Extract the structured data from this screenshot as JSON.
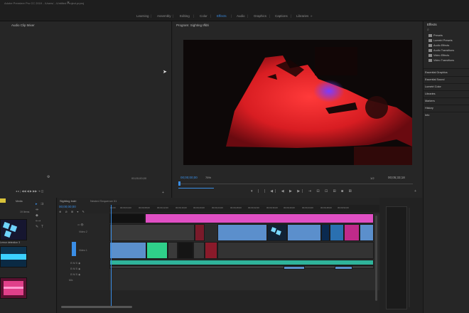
{
  "app": {
    "window_title": "Adobe Premiere Pro CC 2019 - /Users/.../Untitled Project.prproj"
  },
  "workspaces": [
    {
      "label": "Learning",
      "active": false
    },
    {
      "label": "Assembly",
      "active": false
    },
    {
      "label": "Editing",
      "active": false
    },
    {
      "label": "Color",
      "active": false
    },
    {
      "label": "Effects",
      "active": true
    },
    {
      "label": "Audio",
      "active": false
    },
    {
      "label": "Graphics",
      "active": false
    },
    {
      "label": "Captions",
      "active": false
    },
    {
      "label": "Libraries",
      "active": false
    }
  ],
  "source_panel": {
    "tab": "Audio Clip Mixer",
    "timecode": "00;00;00;00"
  },
  "program_panel": {
    "tab": "Program: Sighting Indri",
    "timecode": "00;00;00;00",
    "zoom": "75%",
    "resolution": "1/2",
    "duration": "00;05;33;18"
  },
  "effects_panel": {
    "title": "Effects",
    "search_icon": "search-icon",
    "folders": [
      "Presets",
      "Lumetri Presets",
      "Audio Effects",
      "Audio Transitions",
      "Video Effects",
      "Video Transitions"
    ],
    "sections": [
      "Essential Graphics",
      "Essential Sound",
      "Lumetri Color",
      "Libraries",
      "Markers",
      "History",
      "Info"
    ]
  },
  "project_panel": {
    "tabs": [
      "Media"
    ],
    "count_label": "19 Items",
    "items": [
      {
        "label": "",
        "color": "#3a3a5a"
      },
      {
        "label": "Lemur detection 3",
        "color": "#1a6fa0"
      },
      {
        "label": "",
        "color": "#c0307a"
      }
    ]
  },
  "timeline": {
    "tabs": [
      "Sighting Indri",
      "Nested Sequence 01"
    ],
    "timecode": "00;00;00;00",
    "ruler": [
      "00;00",
      "00;00;04;00",
      "00;00;08;00",
      "00;00;12;00",
      "00;00;16;00",
      "00;00;20;00",
      "00;00;24;00",
      "00;00;28;00",
      "00;00;32;00",
      "00;00;36;00",
      "00;00;40;00",
      "00;00;44;00",
      "00;00;48;00",
      "00;00;52;00"
    ],
    "tracks": [
      {
        "name": "V3",
        "label": ""
      },
      {
        "name": "V2",
        "label": "Video 2"
      },
      {
        "name": "V1",
        "label": "Video 1"
      },
      {
        "name": "A1",
        "label": ""
      },
      {
        "name": "A2",
        "label": ""
      },
      {
        "name": "A3",
        "label": ""
      }
    ],
    "master": "Mix"
  },
  "colors": {
    "accent": "#3a8ee6",
    "pink": "#e04fc4",
    "clip_blue": "#5b8fcc",
    "audio_green": "#2fb39a"
  }
}
